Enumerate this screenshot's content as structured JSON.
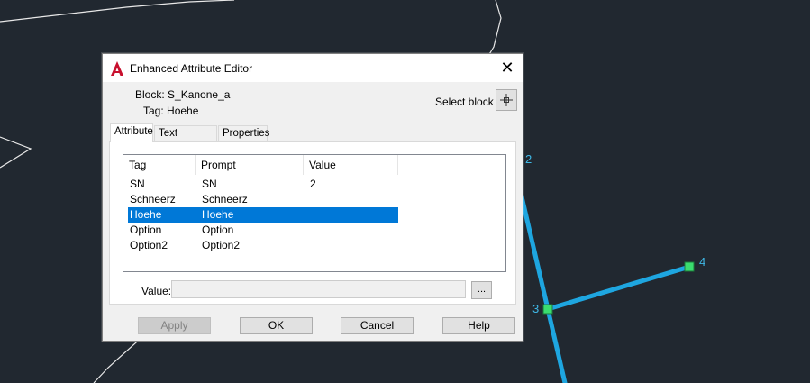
{
  "window": {
    "title": "Enhanced Attribute Editor",
    "close_glyph": "✕"
  },
  "block_info": {
    "block_label": "Block:",
    "block_value": "S_Kanone_a",
    "tag_label": "Tag:",
    "tag_value": "Hoehe",
    "select_block_label": "Select block"
  },
  "tabs": [
    {
      "label": "Attribute",
      "active": true
    },
    {
      "label": "Text Options",
      "active": false
    },
    {
      "label": "Properties",
      "active": false
    }
  ],
  "attribute_list": {
    "columns": [
      "Tag",
      "Prompt",
      "Value"
    ],
    "rows": [
      {
        "tag": "SN",
        "prompt": "SN",
        "value": "2"
      },
      {
        "tag": "Schneerz",
        "prompt": "Schneerz",
        "value": ""
      },
      {
        "tag": "Hoehe",
        "prompt": "Hoehe",
        "value": "",
        "selected": true
      },
      {
        "tag": "Option",
        "prompt": "Option",
        "value": ""
      },
      {
        "tag": "Option2",
        "prompt": "Option2",
        "value": ""
      }
    ]
  },
  "value_field": {
    "label": "Value:",
    "value": "",
    "browse_label": "..."
  },
  "buttons": {
    "apply": "Apply",
    "ok": "OK",
    "cancel": "Cancel",
    "help": "Help"
  },
  "drawing": {
    "vertex_labels": [
      "2",
      "3",
      "4"
    ],
    "line_color": "#1ea6e0",
    "grip_color": "#3bdc6e",
    "background": "#212830"
  },
  "colors": {
    "selection": "#0078d7",
    "app_icon": "#c8102e"
  }
}
